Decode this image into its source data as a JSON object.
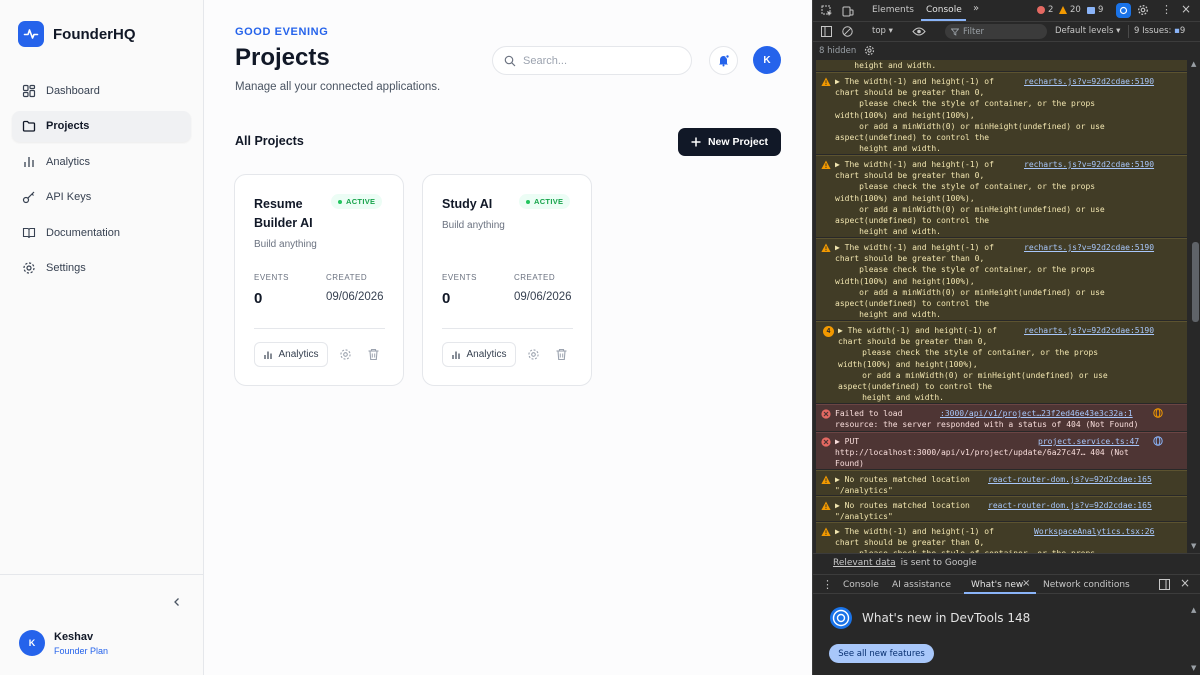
{
  "app": {
    "name": "FounderHQ",
    "accent": "#2563eb"
  },
  "sidebar": {
    "items": [
      {
        "label": "Dashboard",
        "icon": "dashboard-icon"
      },
      {
        "label": "Projects",
        "icon": "folder-icon",
        "active": true
      },
      {
        "label": "Analytics",
        "icon": "bar-chart-icon"
      },
      {
        "label": "API Keys",
        "icon": "key-icon"
      },
      {
        "label": "Documentation",
        "icon": "book-icon"
      },
      {
        "label": "Settings",
        "icon": "gear-icon"
      }
    ],
    "user": {
      "initial": "K",
      "name": "Keshav",
      "plan": "Founder Plan"
    }
  },
  "header": {
    "greeting": "GOOD EVENING",
    "title": "Projects",
    "subtitle": "Manage all your connected applications.",
    "search_placeholder": "Search...",
    "avatar_initial": "K"
  },
  "projects_section": {
    "title": "All Projects",
    "new_button": "New Project"
  },
  "projects": [
    {
      "title": "Resume Builder AI",
      "status": "ACTIVE",
      "description": "Build anything",
      "events_label": "EVENTS",
      "events": "0",
      "created_label": "CREATED",
      "created": "09/06/2026",
      "analytics_label": "Analytics"
    },
    {
      "title": "Study AI",
      "status": "ACTIVE",
      "description": "Build anything",
      "events_label": "EVENTS",
      "events": "0",
      "created_label": "CREATED",
      "created": "09/06/2026",
      "analytics_label": "Analytics"
    }
  ],
  "devtools": {
    "tabs": [
      "Elements",
      "Console"
    ],
    "selected_tab": "Console",
    "error_count": "2",
    "warning_count": "20",
    "info_count": "9",
    "context": "top",
    "filter_placeholder": "Filter",
    "levels": "Default levels",
    "issues": "9 Issues:",
    "issues_count": "9",
    "hidden": "8 hidden",
    "messages": [
      {
        "type": "warn",
        "text": "    height and width.",
        "source": ""
      },
      {
        "type": "warn",
        "text": "▶ The width(-1) and height(-1) of\nchart should be greater than 0,\n     please check the style of container, or the props\nwidth(100%) and height(100%),\n     or add a minWidth(0) or minHeight(undefined) or use\naspect(undefined) to control the\n     height and width.",
        "source": "recharts.js?v=92d2cdae:5190"
      },
      {
        "type": "warn",
        "text": "▶ The width(-1) and height(-1) of\nchart should be greater than 0,\n     please check the style of container, or the props\nwidth(100%) and height(100%),\n     or add a minWidth(0) or minHeight(undefined) or use\naspect(undefined) to control the\n     height and width.",
        "source": "recharts.js?v=92d2cdae:5190"
      },
      {
        "type": "warn",
        "text": "▶ The width(-1) and height(-1) of\nchart should be greater than 0,\n     please check the style of container, or the props\nwidth(100%) and height(100%),\n     or add a minWidth(0) or minHeight(undefined) or use\naspect(undefined) to control the\n     height and width.",
        "source": "recharts.js?v=92d2cdae:5190"
      },
      {
        "type": "warn",
        "count": "4",
        "text": "▶ The width(-1) and height(-1) of\nchart should be greater than 0,\n     please check the style of container, or the props\nwidth(100%) and height(100%),\n     or add a minWidth(0) or minHeight(undefined) or use\naspect(undefined) to control the\n     height and width.",
        "source": "recharts.js?v=92d2cdae:5190"
      },
      {
        "type": "err",
        "text": "Failed to load\nresource: the server responded with a status of 404 (Not Found)",
        "source": ":3000/api/v1/project…23f2ed46e43e3c32a:1"
      },
      {
        "type": "err",
        "text": "▶ PUT\nhttp://localhost:3000/api/v1/project/update/6a27c47… 404 (Not\nFound)",
        "source": "project.service.ts:47"
      },
      {
        "type": "warn",
        "text": "▶ No routes matched location\n\"/analytics\"",
        "source": "react-router-dom.js?v=92d2cdae:165"
      },
      {
        "type": "warn",
        "text": "▶ No routes matched location\n\"/analytics\"",
        "source": "react-router-dom.js?v=92d2cdae:165"
      },
      {
        "type": "warn",
        "text": "▶ The width(-1) and height(-1) of\nchart should be greater than 0,\n     please check the style of container, or the props",
        "source": "WorkspaceAnalytics.tsx:26"
      }
    ],
    "relevant_link": "Relevant data",
    "relevant_text": "is sent to Google",
    "drawer_tabs": [
      "Console",
      "AI assistance",
      "What's new",
      "Network conditions"
    ],
    "drawer_selected": "What's new",
    "whats_new_title": "What's new in DevTools 148",
    "see_all": "See all new features"
  }
}
